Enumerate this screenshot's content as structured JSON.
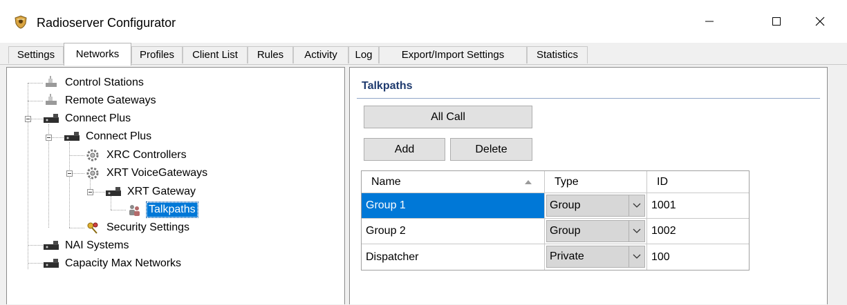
{
  "window": {
    "title": "Radioserver Configurator",
    "icon": "app-shield-icon"
  },
  "tabs": [
    {
      "label": "Settings",
      "active": false
    },
    {
      "label": "Networks",
      "active": true
    },
    {
      "label": "Profiles",
      "active": false
    },
    {
      "label": "Client List",
      "active": false
    },
    {
      "label": "Rules",
      "active": false
    },
    {
      "label": "Activity",
      "active": false
    },
    {
      "label": "Log",
      "active": false
    },
    {
      "label": "Export/Import Settings",
      "active": false
    },
    {
      "label": "Statistics",
      "active": false
    }
  ],
  "tree": [
    {
      "label": "Control Stations",
      "icon": "radio-station-icon"
    },
    {
      "label": "Remote Gateways",
      "icon": "radio-station-icon"
    },
    {
      "label": "Connect Plus",
      "icon": "network-device-icon"
    },
    {
      "label": "Connect Plus",
      "icon": "network-device-icon"
    },
    {
      "label": "XRC Controllers",
      "icon": "gear-icon"
    },
    {
      "label": "XRT VoiceGateways",
      "icon": "gear-icon"
    },
    {
      "label": "XRT Gateway",
      "icon": "network-device-icon"
    },
    {
      "label": "Talkpaths",
      "icon": "people-icon",
      "selected": true
    },
    {
      "label": "Security Settings",
      "icon": "keys-icon"
    },
    {
      "label": "NAI Systems",
      "icon": "network-device-icon"
    },
    {
      "label": "Capacity Max Networks",
      "icon": "network-device-icon"
    }
  ],
  "talkpaths": {
    "title": "Talkpaths",
    "all_call_label": "All Call",
    "add_label": "Add",
    "delete_label": "Delete",
    "columns": [
      "Name",
      "Type",
      "ID"
    ],
    "rows": [
      {
        "name": "Group 1",
        "type": "Group",
        "id": "1001",
        "selected": true
      },
      {
        "name": "Group 2",
        "type": "Group",
        "id": "1002"
      },
      {
        "name": "Dispatcher",
        "type": "Private",
        "id": "100"
      }
    ]
  },
  "colors": {
    "selection": "#0078d7",
    "section_title": "#1e3a6e",
    "panel_bg": "#f0f0f0"
  }
}
